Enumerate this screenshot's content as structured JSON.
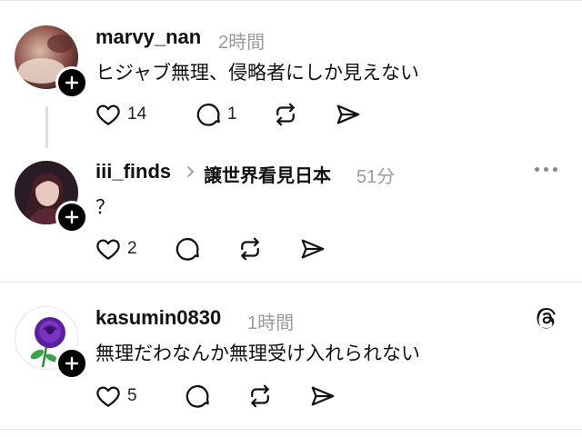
{
  "posts": [
    {
      "username": "marvy_nan",
      "time": "2時間",
      "text": "ヒジャブ無理、侵略者にしか見えない",
      "likes": "14",
      "replies": "1"
    },
    {
      "username": "iii_finds",
      "reply_to": "譲世界看見日本",
      "time": "51分",
      "text": "？",
      "likes": "2"
    },
    {
      "username": "kasumin0830",
      "time": "1時間",
      "text": "無理だわなんか無理受け入れられない",
      "likes": "5"
    }
  ],
  "icons": {
    "like": "heart-icon",
    "reply": "comment-icon",
    "repost": "repost-icon",
    "share": "send-icon",
    "follow": "plus-icon",
    "more": "more-options-icon",
    "app": "threads-logo-icon"
  }
}
